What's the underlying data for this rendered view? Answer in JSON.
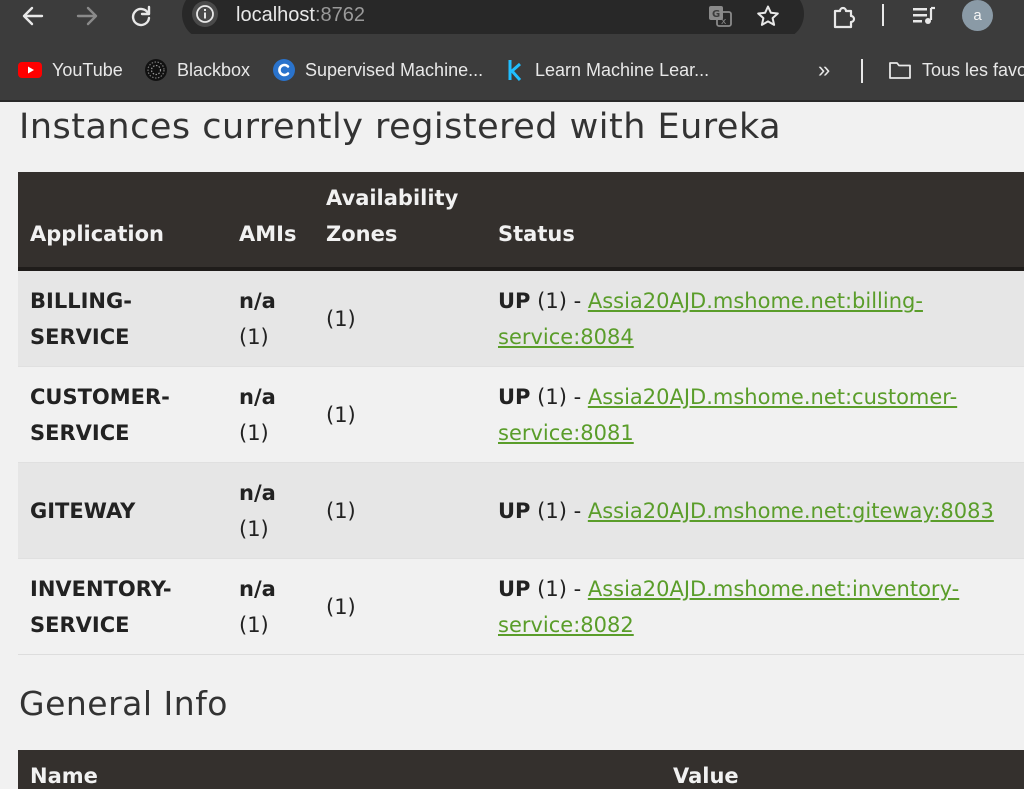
{
  "browser": {
    "url_host": "localhost",
    "url_port": ":8762",
    "avatar_letter": "a",
    "bookmarks": [
      {
        "label": "YouTube",
        "icon": "youtube-icon"
      },
      {
        "label": "Blackbox",
        "icon": "blackbox-icon"
      },
      {
        "label": "Supervised Machine...",
        "icon": "coursera-icon"
      },
      {
        "label": "Learn Machine Lear...",
        "icon": "kaggle-icon"
      }
    ],
    "overflow_label": "»",
    "all_bookmarks_label": "Tous les favo"
  },
  "page": {
    "instances_title": "Instances currently registered with Eureka",
    "general_info_title": "General Info",
    "table_headers": {
      "application": "Application",
      "amis": "AMIs",
      "zones": "Availability Zones",
      "status": "Status"
    },
    "instances": [
      {
        "application": "BILLING-SERVICE",
        "amis": "n/a",
        "amis_count": "(1)",
        "zones": "(1)",
        "status": "UP",
        "status_count": "(1) -",
        "link": "Assia20AJD.mshome.net:billing-service:8084"
      },
      {
        "application": "CUSTOMER-SERVICE",
        "amis": "n/a",
        "amis_count": "(1)",
        "zones": "(1)",
        "status": "UP",
        "status_count": "(1) -",
        "link": "Assia20AJD.mshome.net:customer-service:8081"
      },
      {
        "application": "GITEWAY",
        "amis": "n/a",
        "amis_count": "(1)",
        "zones": "(1)",
        "status": "UP",
        "status_count": "(1) -",
        "link": "Assia20AJD.mshome.net:giteway:8083"
      },
      {
        "application": "INVENTORY-SERVICE",
        "amis": "n/a",
        "amis_count": "(1)",
        "zones": "(1)",
        "status": "UP",
        "status_count": "(1) -",
        "link": "Assia20AJD.mshome.net:inventory-service:8082"
      }
    ],
    "general_info_headers": {
      "name": "Name",
      "value": "Value"
    },
    "colors": {
      "link": "#5a9d2a",
      "header_bg": "#34302d",
      "page_bg": "#f1f1f1"
    }
  }
}
